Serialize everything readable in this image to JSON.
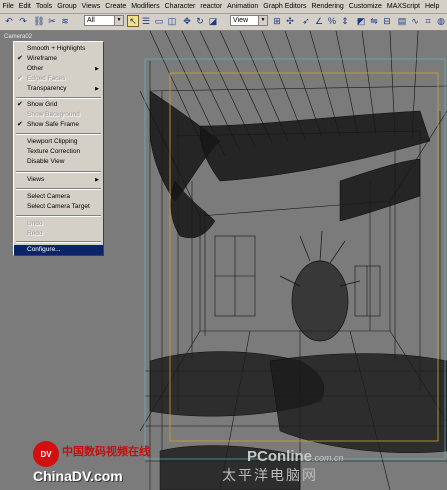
{
  "menubar": {
    "items": [
      "File",
      "Edit",
      "Tools",
      "Group",
      "Views",
      "Create",
      "Modifiers",
      "Character",
      "reactor",
      "Animation",
      "Graph Editors",
      "Rendering",
      "Customize",
      "MAXScript",
      "Help"
    ]
  },
  "toolbar": {
    "selection_filter": "All",
    "reference_coord": "View"
  },
  "viewport": {
    "label": "Camera02"
  },
  "context_menu": {
    "items": [
      {
        "label": "Smooth + Highlights",
        "checked": false,
        "submenu": false,
        "disabled": false
      },
      {
        "label": "Wireframe",
        "checked": true,
        "submenu": false,
        "disabled": false
      },
      {
        "label": "Other",
        "checked": false,
        "submenu": true,
        "disabled": false
      },
      {
        "label": "Edged Faces",
        "checked": true,
        "submenu": false,
        "disabled": true
      },
      {
        "label": "Transparency",
        "checked": false,
        "submenu": true,
        "disabled": false
      },
      {
        "label": "Show Grid",
        "checked": true,
        "submenu": false,
        "disabled": false
      },
      {
        "label": "Show Background",
        "checked": false,
        "submenu": false,
        "disabled": true
      },
      {
        "label": "Show Safe Frame",
        "checked": true,
        "submenu": false,
        "disabled": false
      },
      {
        "label": "Viewport Clipping",
        "checked": false,
        "submenu": false,
        "disabled": false
      },
      {
        "label": "Texture Correction",
        "checked": false,
        "submenu": false,
        "disabled": false
      },
      {
        "label": "Disable View",
        "checked": false,
        "submenu": false,
        "disabled": false
      },
      {
        "label": "Views",
        "checked": false,
        "submenu": true,
        "disabled": false
      },
      {
        "label": "Select Camera",
        "checked": false,
        "submenu": false,
        "disabled": false
      },
      {
        "label": "Select Camera Target",
        "checked": false,
        "submenu": false,
        "disabled": false
      },
      {
        "label": "Undo",
        "checked": false,
        "submenu": false,
        "disabled": true
      },
      {
        "label": "Redo",
        "checked": false,
        "submenu": false,
        "disabled": true
      },
      {
        "label": "Configure...",
        "checked": false,
        "submenu": false,
        "disabled": false,
        "selected": true
      }
    ]
  },
  "watermarks": {
    "logo_text": "DV",
    "chinese_title": "中国数码视频在线",
    "chinadv": "ChinaDV.com",
    "pconline": "PConline",
    "pconline_suffix": ".com.cn",
    "pconline_sub": "太平洋电脑网"
  },
  "colors": {
    "viewport_bg": "#7b7b7b",
    "wire": "#141414",
    "safe_frame_yellow": "#c8a830",
    "safe_frame_cyan": "#60c0d0",
    "menu_highlight": "#0a246a"
  }
}
